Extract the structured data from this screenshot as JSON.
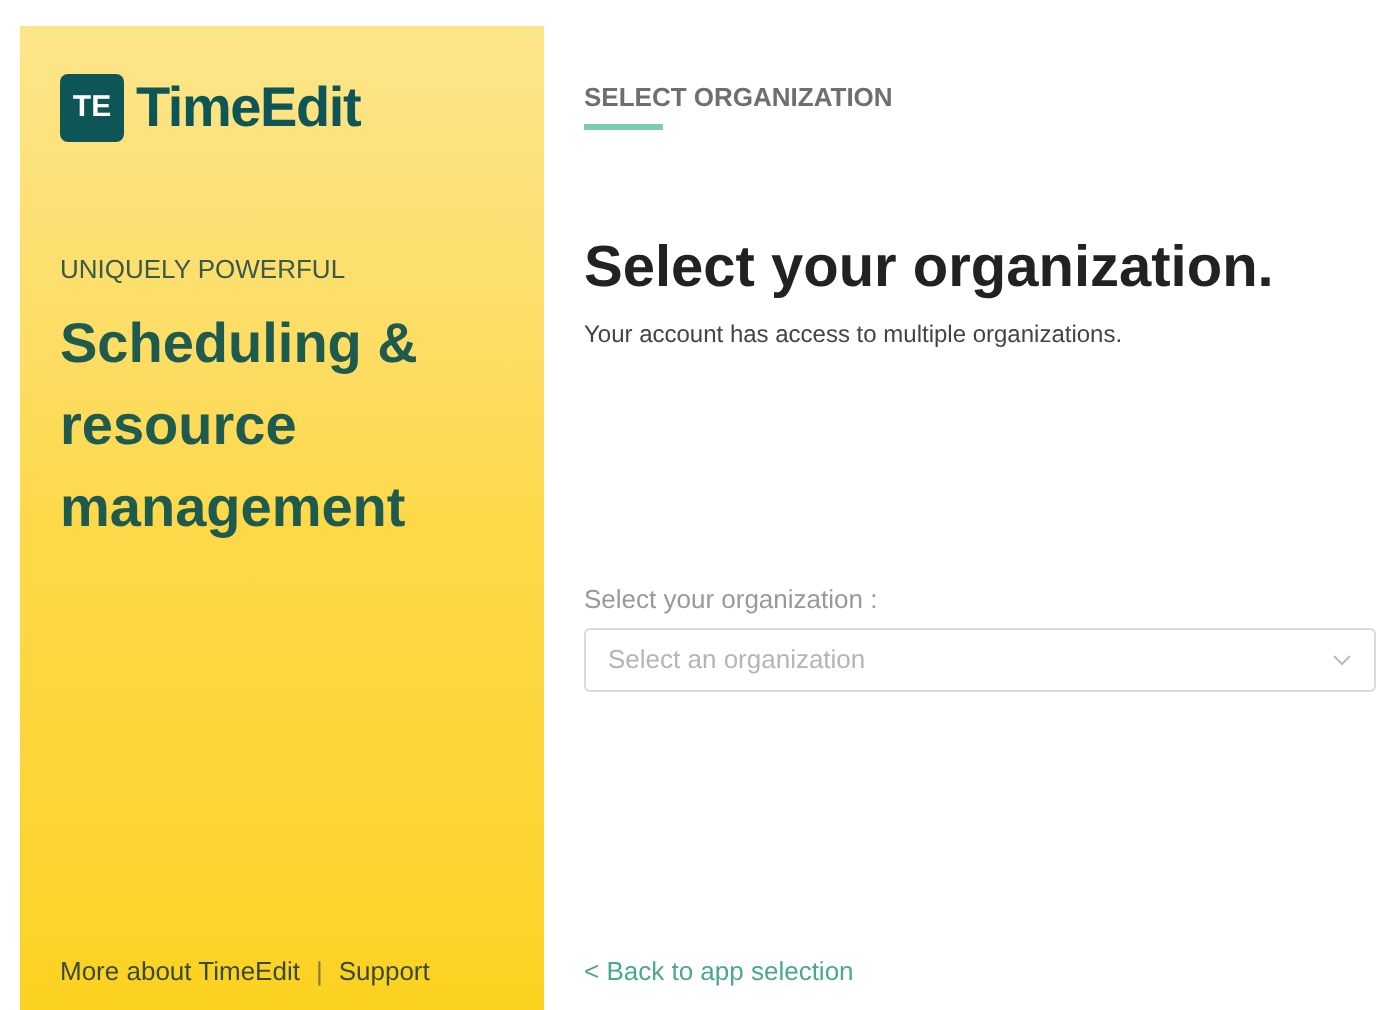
{
  "brand": {
    "logo_mark": "TE",
    "name": "TimeEdit"
  },
  "promo": {
    "eyebrow": "UNIQUELY POWERFUL",
    "headline": "Scheduling & resource management"
  },
  "footer_links": [
    {
      "label": "More about TimeEdit"
    },
    {
      "label": "Support"
    }
  ],
  "footer_separator": "|",
  "step_tab": {
    "label": "SELECT ORGANIZATION",
    "selected": true
  },
  "title": "Select your organization.",
  "subtitle": "Your account has access to multiple organizations.",
  "field": {
    "label": "Select your organization :",
    "placeholder": "Select an organization"
  },
  "back_link": "< Back to app selection"
}
